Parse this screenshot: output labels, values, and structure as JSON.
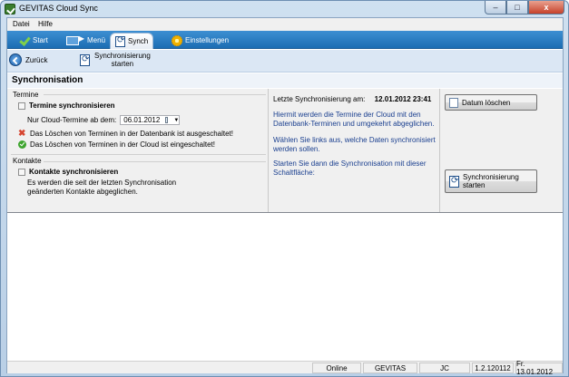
{
  "window": {
    "title": "GEVITAS Cloud Sync",
    "controls": {
      "minimize": "–",
      "maximize": "□",
      "close": "x"
    }
  },
  "menubar": {
    "file": "Datei",
    "help": "Hilfe"
  },
  "tabs": [
    {
      "label": "Start",
      "icon": "checkmark-icon"
    },
    {
      "label": "Menü",
      "icon": "menu-icon"
    },
    {
      "label": "Synch",
      "icon": "sync-icon",
      "active": true
    },
    {
      "label": "Einstellungen",
      "icon": "gear-icon"
    }
  ],
  "toolbar": {
    "back_label": "Zurück",
    "sync_line1": "Synchronisierung",
    "sync_line2": "starten"
  },
  "page": {
    "title": "Synchronisation"
  },
  "termine": {
    "section_label": "Termine",
    "checkbox_label": "Termine synchronisieren",
    "checked": false,
    "date_label": "Nur Cloud-Termine ab dem:",
    "date_value": "06.01.2012",
    "status_db": "Das Löschen von Terminen in der Datenbank ist ausgeschaltet!",
    "status_cloud": "Das Löschen von Terminen in der Cloud ist eingeschaltet!"
  },
  "kontakte": {
    "section_label": "Kontakte",
    "checkbox_label": "Kontakte synchronisieren",
    "checked": false,
    "desc_line1": "Es werden die seit der letzten Synchronisation",
    "desc_line2": "geänderten Kontakte abgeglichen."
  },
  "info": {
    "last_sync_label": "Letzte Synchronisierung am:",
    "last_sync_value": "12.01.2012 23:41",
    "p1_line1": "Hiermit werden die Termine der Cloud mit den",
    "p1_line2": "Datenbank-Terminen und umgekehrt abgeglichen.",
    "p2_line1": "Wählen Sie links aus, welche Daten synchronisiert",
    "p2_line2": "werden sollen.",
    "p3_line1": "Starten Sie dann die Synchronisation mit dieser",
    "p3_line2": "Schaltfläche:"
  },
  "buttons": {
    "clear_date": "Datum löschen",
    "start_sync_line1": "Synchronisierung",
    "start_sync_line2": "starten"
  },
  "statusbar": {
    "online": "Online",
    "company": "GEVITAS",
    "user": "JC",
    "version": "1.2.120112",
    "date": "Fr. 13.01.2012"
  }
}
